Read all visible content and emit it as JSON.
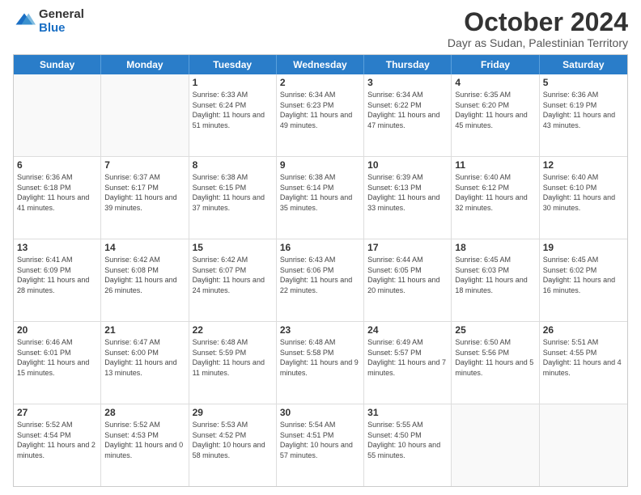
{
  "header": {
    "logo_general": "General",
    "logo_blue": "Blue",
    "main_title": "October 2024",
    "subtitle": "Dayr as Sudan, Palestinian Territory"
  },
  "calendar": {
    "days_of_week": [
      "Sunday",
      "Monday",
      "Tuesday",
      "Wednesday",
      "Thursday",
      "Friday",
      "Saturday"
    ],
    "rows": [
      [
        {
          "day": "",
          "empty": true
        },
        {
          "day": "",
          "empty": true
        },
        {
          "day": "1",
          "sunrise": "6:33 AM",
          "sunset": "6:24 PM",
          "daylight": "11 hours and 51 minutes."
        },
        {
          "day": "2",
          "sunrise": "6:34 AM",
          "sunset": "6:23 PM",
          "daylight": "11 hours and 49 minutes."
        },
        {
          "day": "3",
          "sunrise": "6:34 AM",
          "sunset": "6:22 PM",
          "daylight": "11 hours and 47 minutes."
        },
        {
          "day": "4",
          "sunrise": "6:35 AM",
          "sunset": "6:20 PM",
          "daylight": "11 hours and 45 minutes."
        },
        {
          "day": "5",
          "sunrise": "6:36 AM",
          "sunset": "6:19 PM",
          "daylight": "11 hours and 43 minutes."
        }
      ],
      [
        {
          "day": "6",
          "sunrise": "6:36 AM",
          "sunset": "6:18 PM",
          "daylight": "11 hours and 41 minutes."
        },
        {
          "day": "7",
          "sunrise": "6:37 AM",
          "sunset": "6:17 PM",
          "daylight": "11 hours and 39 minutes."
        },
        {
          "day": "8",
          "sunrise": "6:38 AM",
          "sunset": "6:15 PM",
          "daylight": "11 hours and 37 minutes."
        },
        {
          "day": "9",
          "sunrise": "6:38 AM",
          "sunset": "6:14 PM",
          "daylight": "11 hours and 35 minutes."
        },
        {
          "day": "10",
          "sunrise": "6:39 AM",
          "sunset": "6:13 PM",
          "daylight": "11 hours and 33 minutes."
        },
        {
          "day": "11",
          "sunrise": "6:40 AM",
          "sunset": "6:12 PM",
          "daylight": "11 hours and 32 minutes."
        },
        {
          "day": "12",
          "sunrise": "6:40 AM",
          "sunset": "6:10 PM",
          "daylight": "11 hours and 30 minutes."
        }
      ],
      [
        {
          "day": "13",
          "sunrise": "6:41 AM",
          "sunset": "6:09 PM",
          "daylight": "11 hours and 28 minutes."
        },
        {
          "day": "14",
          "sunrise": "6:42 AM",
          "sunset": "6:08 PM",
          "daylight": "11 hours and 26 minutes."
        },
        {
          "day": "15",
          "sunrise": "6:42 AM",
          "sunset": "6:07 PM",
          "daylight": "11 hours and 24 minutes."
        },
        {
          "day": "16",
          "sunrise": "6:43 AM",
          "sunset": "6:06 PM",
          "daylight": "11 hours and 22 minutes."
        },
        {
          "day": "17",
          "sunrise": "6:44 AM",
          "sunset": "6:05 PM",
          "daylight": "11 hours and 20 minutes."
        },
        {
          "day": "18",
          "sunrise": "6:45 AM",
          "sunset": "6:03 PM",
          "daylight": "11 hours and 18 minutes."
        },
        {
          "day": "19",
          "sunrise": "6:45 AM",
          "sunset": "6:02 PM",
          "daylight": "11 hours and 16 minutes."
        }
      ],
      [
        {
          "day": "20",
          "sunrise": "6:46 AM",
          "sunset": "6:01 PM",
          "daylight": "11 hours and 15 minutes."
        },
        {
          "day": "21",
          "sunrise": "6:47 AM",
          "sunset": "6:00 PM",
          "daylight": "11 hours and 13 minutes."
        },
        {
          "day": "22",
          "sunrise": "6:48 AM",
          "sunset": "5:59 PM",
          "daylight": "11 hours and 11 minutes."
        },
        {
          "day": "23",
          "sunrise": "6:48 AM",
          "sunset": "5:58 PM",
          "daylight": "11 hours and 9 minutes."
        },
        {
          "day": "24",
          "sunrise": "6:49 AM",
          "sunset": "5:57 PM",
          "daylight": "11 hours and 7 minutes."
        },
        {
          "day": "25",
          "sunrise": "6:50 AM",
          "sunset": "5:56 PM",
          "daylight": "11 hours and 5 minutes."
        },
        {
          "day": "26",
          "sunrise": "5:51 AM",
          "sunset": "4:55 PM",
          "daylight": "11 hours and 4 minutes."
        }
      ],
      [
        {
          "day": "27",
          "sunrise": "5:52 AM",
          "sunset": "4:54 PM",
          "daylight": "11 hours and 2 minutes."
        },
        {
          "day": "28",
          "sunrise": "5:52 AM",
          "sunset": "4:53 PM",
          "daylight": "11 hours and 0 minutes."
        },
        {
          "day": "29",
          "sunrise": "5:53 AM",
          "sunset": "4:52 PM",
          "daylight": "10 hours and 58 minutes."
        },
        {
          "day": "30",
          "sunrise": "5:54 AM",
          "sunset": "4:51 PM",
          "daylight": "10 hours and 57 minutes."
        },
        {
          "day": "31",
          "sunrise": "5:55 AM",
          "sunset": "4:50 PM",
          "daylight": "10 hours and 55 minutes."
        },
        {
          "day": "",
          "empty": true
        },
        {
          "day": "",
          "empty": true
        }
      ]
    ]
  }
}
